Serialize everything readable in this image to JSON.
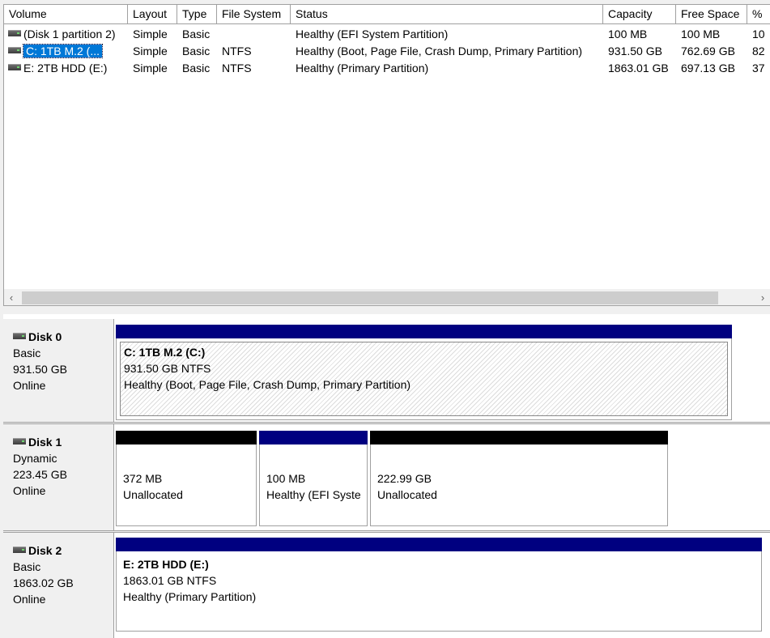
{
  "volume_list": {
    "columns": [
      "Volume",
      "Layout",
      "Type",
      "File System",
      "Status",
      "Capacity",
      "Free Space",
      "%"
    ],
    "rows": [
      {
        "volume": "(Disk 1 partition 2)",
        "layout": "Simple",
        "type": "Basic",
        "fs": "",
        "status": "Healthy (EFI System Partition)",
        "capacity": "100 MB",
        "free": "100 MB",
        "pct": "10"
      },
      {
        "volume": "C: 1TB M.2 (...",
        "layout": "Simple",
        "type": "Basic",
        "fs": "NTFS",
        "status": "Healthy (Boot, Page File, Crash Dump, Primary Partition)",
        "capacity": "931.50 GB",
        "free": "762.69 GB",
        "pct": "82"
      },
      {
        "volume": "E: 2TB HDD (E:)",
        "layout": "Simple",
        "type": "Basic",
        "fs": "NTFS",
        "status": "Healthy (Primary Partition)",
        "capacity": "1863.01 GB",
        "free": "697.13 GB",
        "pct": "37"
      }
    ],
    "scroll_left": "‹",
    "scroll_right": "›"
  },
  "disks": [
    {
      "name": "Disk 0",
      "kind": "Basic",
      "size": "931.50 GB",
      "state": "Online",
      "partitions": [
        {
          "title": "C: 1TB M.2  (C:)",
          "line1": "931.50 GB NTFS",
          "line2": "Healthy (Boot, Page File, Crash Dump, Primary Partition)",
          "bar_color": "#000080"
        }
      ]
    },
    {
      "name": "Disk 1",
      "kind": "Dynamic",
      "size": "223.45 GB",
      "state": "Online",
      "partitions": [
        {
          "title": "",
          "line1": "372 MB",
          "line2": "Unallocated",
          "bar_color": "#000000"
        },
        {
          "title": "",
          "line1": "100 MB",
          "line2": "Healthy (EFI Syste",
          "bar_color": "#000080"
        },
        {
          "title": "",
          "line1": "222.99 GB",
          "line2": "Unallocated",
          "bar_color": "#000000"
        }
      ]
    },
    {
      "name": "Disk 2",
      "kind": "Basic",
      "size": "1863.02 GB",
      "state": "Online",
      "partitions": [
        {
          "title": "E: 2TB HDD  (E:)",
          "line1": "1863.01 GB NTFS",
          "line2": "Healthy (Primary Partition)",
          "bar_color": "#000080"
        }
      ]
    }
  ],
  "icons": {
    "drive": "drive-icon"
  }
}
